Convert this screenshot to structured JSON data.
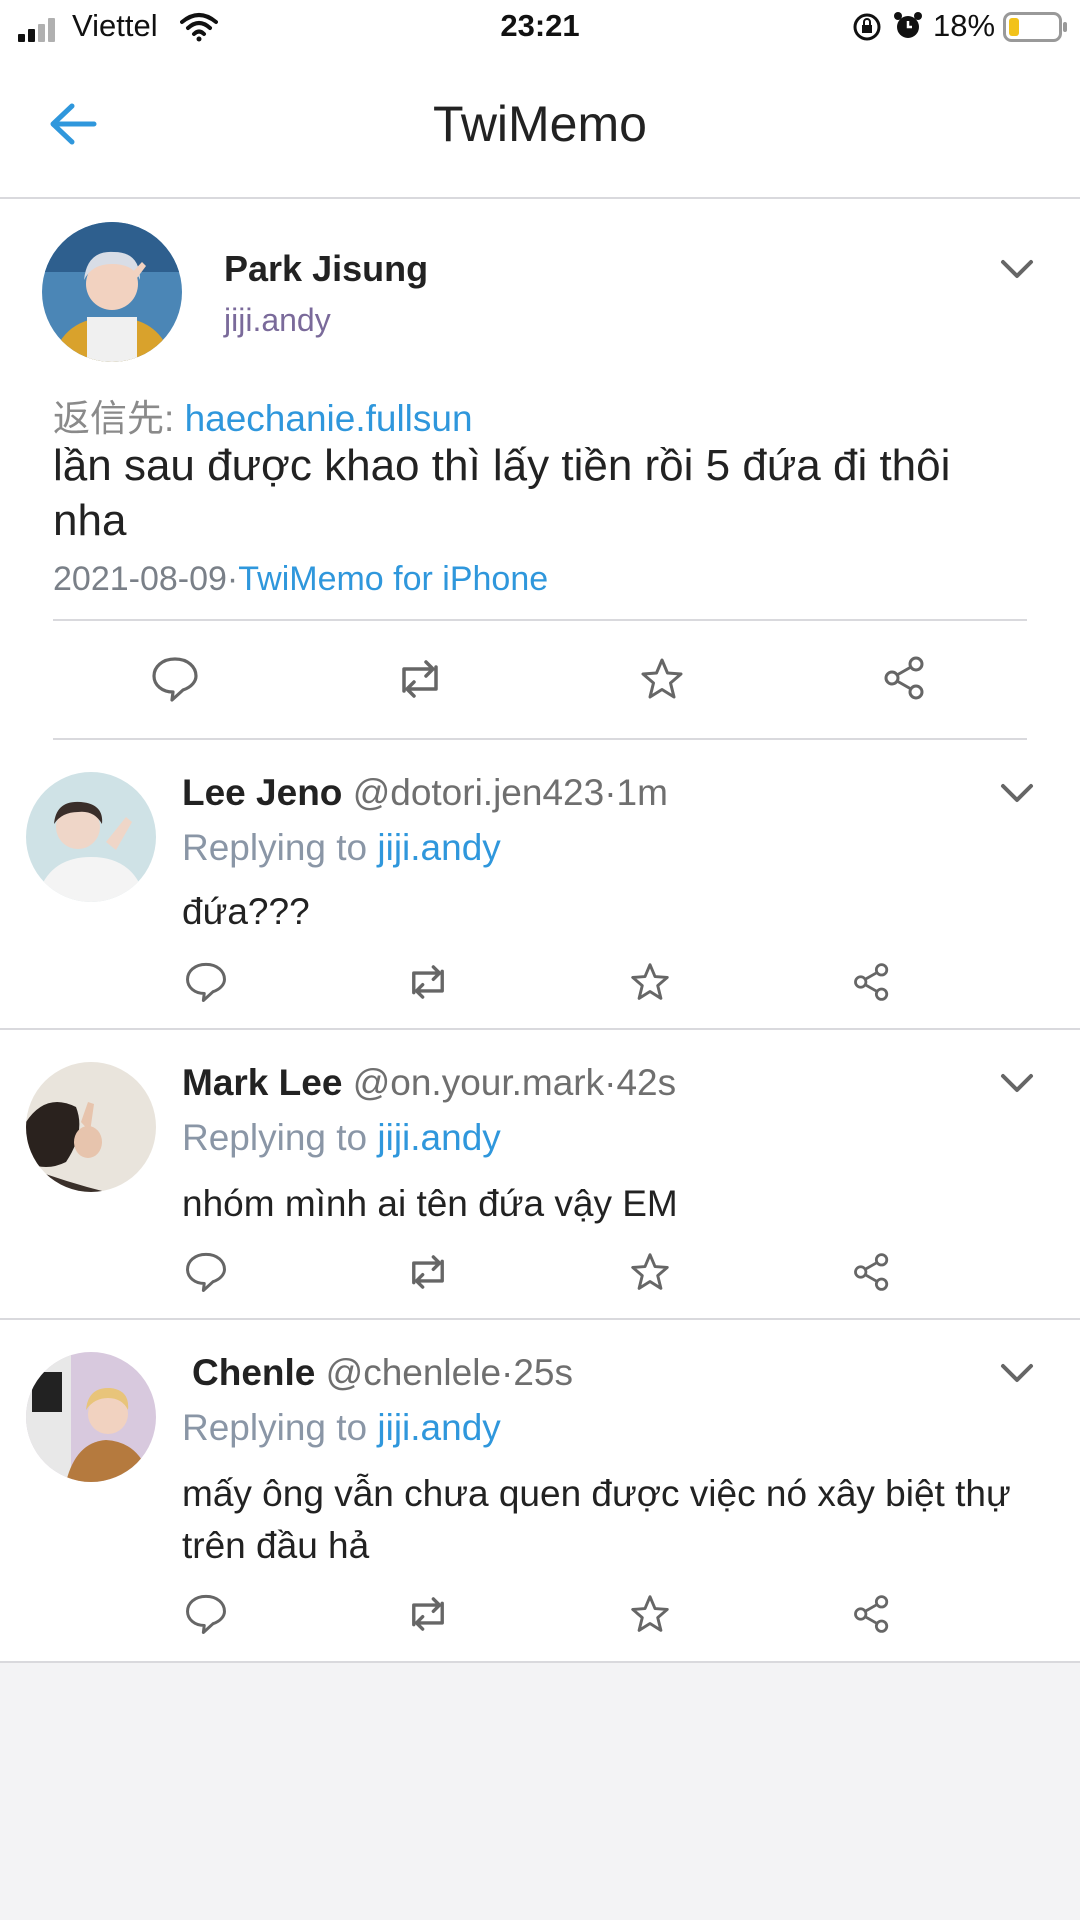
{
  "status_bar": {
    "carrier": "Viettel",
    "time": "23:21",
    "battery": "18%"
  },
  "nav": {
    "title": "TwiMemo",
    "back_icon": "back-arrow-icon"
  },
  "main_tweet": {
    "name": "Park Jisung",
    "handle": "jiji.andy",
    "reply_prefix": "返信先:",
    "reply_to": "haechanie.fullsun",
    "text": "lần sau được khao thì lấy tiền rồi 5 đứa đi thôi nha",
    "date": "2021-08-09",
    "dot": "·",
    "source": "TwiMemo for iPhone"
  },
  "replies": [
    {
      "name": "Lee Jeno",
      "handle": "@dotori.jen423",
      "time": "·1m",
      "replying_label": "Replying to",
      "replying_to": "jiji.andy",
      "text": "đứa???"
    },
    {
      "name": "Mark Lee",
      "handle": "@on.your.mark",
      "time": "·42s",
      "replying_label": "Replying to",
      "replying_to": "jiji.andy",
      "text": "nhóm mình ai tên đứa vậy EM"
    },
    {
      "name": "Chenle",
      "handle": "@chenlele",
      "time": "·25s",
      "replying_label": "Replying to",
      "replying_to": "jiji.andy",
      "text": "mấy ông vẫn chưa quen được việc nó xây biệt thự trên đầu hả"
    }
  ],
  "colors": {
    "accent": "#2f97dc",
    "background": "#f3f3f5",
    "divider": "#d9d9dd"
  }
}
